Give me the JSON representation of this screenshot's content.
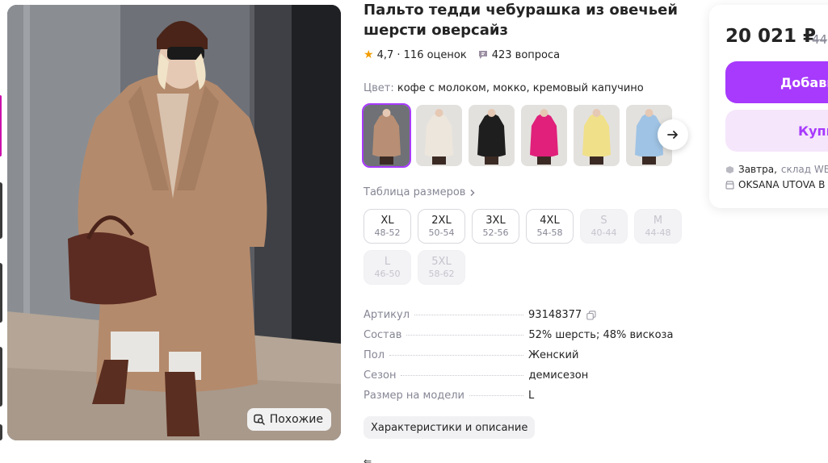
{
  "product": {
    "title": "Пальто тедди чебурашка из овечьей шерсти оверсайз",
    "rating": "4,7",
    "reviews": "116 оценок",
    "questions": "423 вопроса"
  },
  "color": {
    "label": "Цвет:",
    "value": "кофе с молоком, мокко, кремовый капучино"
  },
  "variants": [
    {
      "name": "coffee",
      "color": "#b88f74"
    },
    {
      "name": "white",
      "color": "#ede6dc"
    },
    {
      "name": "black",
      "color": "#1e1e1e"
    },
    {
      "name": "fuchsia",
      "color": "#e0207a"
    },
    {
      "name": "yellow",
      "color": "#f0e08a"
    },
    {
      "name": "blue",
      "color": "#9fc3e4"
    }
  ],
  "size_table": {
    "label": "Таблица размеров"
  },
  "sizes": [
    {
      "name": "XL",
      "range": "48-52",
      "available": true
    },
    {
      "name": "2XL",
      "range": "50-54",
      "available": true
    },
    {
      "name": "3XL",
      "range": "52-56",
      "available": true
    },
    {
      "name": "4XL",
      "range": "54-58",
      "available": true
    },
    {
      "name": "S",
      "range": "40-44",
      "available": false
    },
    {
      "name": "M",
      "range": "44-48",
      "available": false
    },
    {
      "name": "L",
      "range": "46-50",
      "available": false
    },
    {
      "name": "5XL",
      "range": "58-62",
      "available": false
    }
  ],
  "specs": [
    {
      "key": "Артикул",
      "value": "93148377",
      "copy": true
    },
    {
      "key": "Состав",
      "value": "52% шерсть; 48% вискоза"
    },
    {
      "key": "Пол",
      "value": "Женский"
    },
    {
      "key": "Сезон",
      "value": "демисезон"
    },
    {
      "key": "Размер на модели",
      "value": "L"
    }
  ],
  "description_button": "Характеристики и описание",
  "similar_button": "Похожие",
  "buy_card": {
    "price": "20 021 ₽",
    "old_price": "44",
    "add_to_cart": "Добави",
    "buy_now": "Купи",
    "delivery_day": "Завтра,",
    "delivery_source": "склад WB",
    "seller": "OKSANA UTOVA B"
  },
  "colors": {
    "accent": "#a73afd",
    "accent_soft": "#f5e6fb",
    "star": "#f29d00",
    "muted": "#868695"
  }
}
